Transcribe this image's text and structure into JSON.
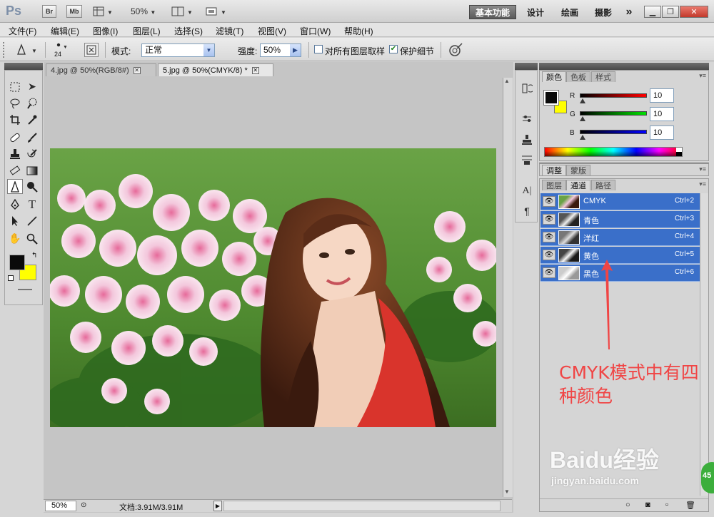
{
  "app": {
    "logo": "Ps",
    "bridge_btn": "Br",
    "minibridge_btn": "Mb",
    "zoom_select": "50%",
    "workspaces": [
      "基本功能",
      "设计",
      "绘画",
      "摄影"
    ],
    "more": "»"
  },
  "menu": [
    "文件(F)",
    "编辑(E)",
    "图像(I)",
    "图层(L)",
    "选择(S)",
    "滤镜(T)",
    "视图(V)",
    "窗口(W)",
    "帮助(H)"
  ],
  "options": {
    "brush_size": "24",
    "mode_label": "模式:",
    "mode_value": "正常",
    "strength_label": "强度:",
    "strength_value": "50%",
    "sample_all_label": "对所有图层取样",
    "protect_detail_label": "保护细节"
  },
  "doc_tabs": [
    {
      "label": "4.jpg @ 50%(RGB/8#)",
      "active": false
    },
    {
      "label": "5.jpg @ 50%(CMYK/8) *",
      "active": true
    }
  ],
  "status": {
    "zoom": "50%",
    "doc_info": "文档:3.91M/3.91M"
  },
  "color_panel": {
    "tabs": [
      "颜色",
      "色板",
      "样式"
    ],
    "channels": [
      {
        "label": "R",
        "value": "10"
      },
      {
        "label": "G",
        "value": "10"
      },
      {
        "label": "B",
        "value": "10"
      }
    ],
    "foreground": "#0a0a0a",
    "background": "#ffff00"
  },
  "adjust_panel": {
    "tabs": [
      "调整",
      "蒙版"
    ]
  },
  "channels_panel": {
    "tabs": [
      "图层",
      "通道",
      "路径"
    ],
    "rows": [
      {
        "name": "CMYK",
        "shortcut": "Ctrl+2"
      },
      {
        "name": "青色",
        "shortcut": "Ctrl+3"
      },
      {
        "name": "洋红",
        "shortcut": "Ctrl+4"
      },
      {
        "name": "黄色",
        "shortcut": "Ctrl+5"
      },
      {
        "name": "黑色",
        "shortcut": "Ctrl+6"
      }
    ]
  },
  "annotation": {
    "line1": "CMYK模式中有四",
    "line2": "种颜色"
  },
  "watermark": {
    "brand": "Baidu经验",
    "url": "jingyan.baidu.com",
    "badge": "45"
  },
  "colors": {
    "accent_blue": "#3a6fc9",
    "annotation_red": "#f04545"
  }
}
